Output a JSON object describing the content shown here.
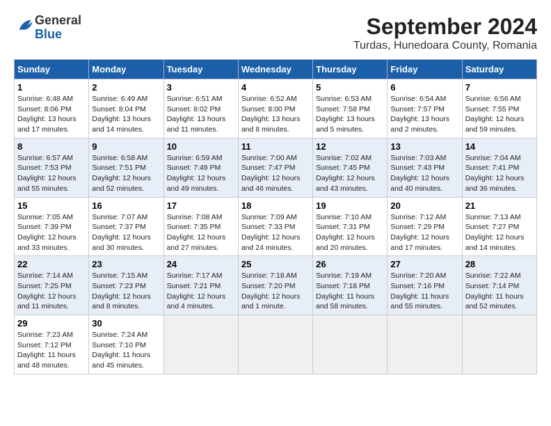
{
  "header": {
    "logo": {
      "line1": "General",
      "line2": "Blue"
    },
    "title": "September 2024",
    "subtitle": "Turdas, Hunedoara County, Romania"
  },
  "columns": [
    "Sunday",
    "Monday",
    "Tuesday",
    "Wednesday",
    "Thursday",
    "Friday",
    "Saturday"
  ],
  "weeks": [
    [
      {
        "day": "1",
        "info": "Sunrise: 6:48 AM\nSunset: 8:06 PM\nDaylight: 13 hours\nand 17 minutes."
      },
      {
        "day": "2",
        "info": "Sunrise: 6:49 AM\nSunset: 8:04 PM\nDaylight: 13 hours\nand 14 minutes."
      },
      {
        "day": "3",
        "info": "Sunrise: 6:51 AM\nSunset: 8:02 PM\nDaylight: 13 hours\nand 11 minutes."
      },
      {
        "day": "4",
        "info": "Sunrise: 6:52 AM\nSunset: 8:00 PM\nDaylight: 13 hours\nand 8 minutes."
      },
      {
        "day": "5",
        "info": "Sunrise: 6:53 AM\nSunset: 7:58 PM\nDaylight: 13 hours\nand 5 minutes."
      },
      {
        "day": "6",
        "info": "Sunrise: 6:54 AM\nSunset: 7:57 PM\nDaylight: 13 hours\nand 2 minutes."
      },
      {
        "day": "7",
        "info": "Sunrise: 6:56 AM\nSunset: 7:55 PM\nDaylight: 12 hours\nand 59 minutes."
      }
    ],
    [
      {
        "day": "8",
        "info": "Sunrise: 6:57 AM\nSunset: 7:53 PM\nDaylight: 12 hours\nand 55 minutes."
      },
      {
        "day": "9",
        "info": "Sunrise: 6:58 AM\nSunset: 7:51 PM\nDaylight: 12 hours\nand 52 minutes."
      },
      {
        "day": "10",
        "info": "Sunrise: 6:59 AM\nSunset: 7:49 PM\nDaylight: 12 hours\nand 49 minutes."
      },
      {
        "day": "11",
        "info": "Sunrise: 7:00 AM\nSunset: 7:47 PM\nDaylight: 12 hours\nand 46 minutes."
      },
      {
        "day": "12",
        "info": "Sunrise: 7:02 AM\nSunset: 7:45 PM\nDaylight: 12 hours\nand 43 minutes."
      },
      {
        "day": "13",
        "info": "Sunrise: 7:03 AM\nSunset: 7:43 PM\nDaylight: 12 hours\nand 40 minutes."
      },
      {
        "day": "14",
        "info": "Sunrise: 7:04 AM\nSunset: 7:41 PM\nDaylight: 12 hours\nand 36 minutes."
      }
    ],
    [
      {
        "day": "15",
        "info": "Sunrise: 7:05 AM\nSunset: 7:39 PM\nDaylight: 12 hours\nand 33 minutes."
      },
      {
        "day": "16",
        "info": "Sunrise: 7:07 AM\nSunset: 7:37 PM\nDaylight: 12 hours\nand 30 minutes."
      },
      {
        "day": "17",
        "info": "Sunrise: 7:08 AM\nSunset: 7:35 PM\nDaylight: 12 hours\nand 27 minutes."
      },
      {
        "day": "18",
        "info": "Sunrise: 7:09 AM\nSunset: 7:33 PM\nDaylight: 12 hours\nand 24 minutes."
      },
      {
        "day": "19",
        "info": "Sunrise: 7:10 AM\nSunset: 7:31 PM\nDaylight: 12 hours\nand 20 minutes."
      },
      {
        "day": "20",
        "info": "Sunrise: 7:12 AM\nSunset: 7:29 PM\nDaylight: 12 hours\nand 17 minutes."
      },
      {
        "day": "21",
        "info": "Sunrise: 7:13 AM\nSunset: 7:27 PM\nDaylight: 12 hours\nand 14 minutes."
      }
    ],
    [
      {
        "day": "22",
        "info": "Sunrise: 7:14 AM\nSunset: 7:25 PM\nDaylight: 12 hours\nand 11 minutes."
      },
      {
        "day": "23",
        "info": "Sunrise: 7:15 AM\nSunset: 7:23 PM\nDaylight: 12 hours\nand 8 minutes."
      },
      {
        "day": "24",
        "info": "Sunrise: 7:17 AM\nSunset: 7:21 PM\nDaylight: 12 hours\nand 4 minutes."
      },
      {
        "day": "25",
        "info": "Sunrise: 7:18 AM\nSunset: 7:20 PM\nDaylight: 12 hours\nand 1 minute."
      },
      {
        "day": "26",
        "info": "Sunrise: 7:19 AM\nSunset: 7:18 PM\nDaylight: 11 hours\nand 58 minutes."
      },
      {
        "day": "27",
        "info": "Sunrise: 7:20 AM\nSunset: 7:16 PM\nDaylight: 11 hours\nand 55 minutes."
      },
      {
        "day": "28",
        "info": "Sunrise: 7:22 AM\nSunset: 7:14 PM\nDaylight: 11 hours\nand 52 minutes."
      }
    ],
    [
      {
        "day": "29",
        "info": "Sunrise: 7:23 AM\nSunset: 7:12 PM\nDaylight: 11 hours\nand 48 minutes."
      },
      {
        "day": "30",
        "info": "Sunrise: 7:24 AM\nSunset: 7:10 PM\nDaylight: 11 hours\nand 45 minutes."
      },
      null,
      null,
      null,
      null,
      null
    ]
  ],
  "colors": {
    "header_bg": "#1a5fa8",
    "header_text": "#ffffff",
    "alt_row_bg": "#e8eef8",
    "normal_row_bg": "#ffffff",
    "empty_bg": "#f0f0f0"
  }
}
